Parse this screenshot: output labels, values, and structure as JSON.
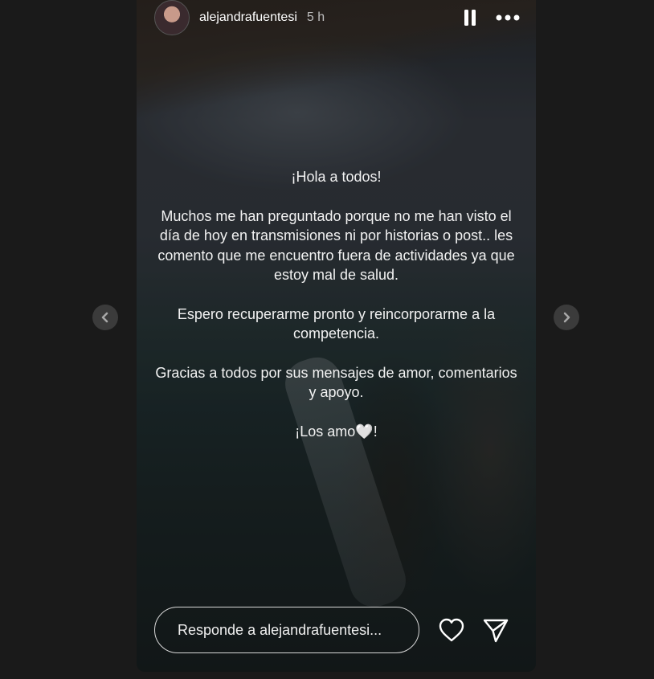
{
  "story": {
    "username": "alejandrafuentesi",
    "time": "5 h",
    "text": {
      "greeting": "¡Hola a todos!",
      "paragraph1": "Muchos me han preguntado porque no me han visto el día de hoy en transmisiones ni por historias o post.. les comento que me encuentro fuera de actividades ya que estoy mal de salud.",
      "paragraph2": "Espero recuperarme pronto y reincorporarme a la competencia.",
      "paragraph3": "Gracias a todos por sus mensajes de amor, comentarios y apoyo.",
      "closing": "¡Los amo🤍!"
    }
  },
  "reply": {
    "placeholder": "Responde a alejandrafuentesi..."
  },
  "icons": {
    "pause": "pause-icon",
    "more": "more-options-icon",
    "prev": "chevron-left-icon",
    "next": "chevron-right-icon",
    "like": "heart-icon",
    "share": "send-icon"
  },
  "colors": {
    "background": "#1a1a1a",
    "text": "#ffffff",
    "nav_button": "#3b3b3b"
  }
}
